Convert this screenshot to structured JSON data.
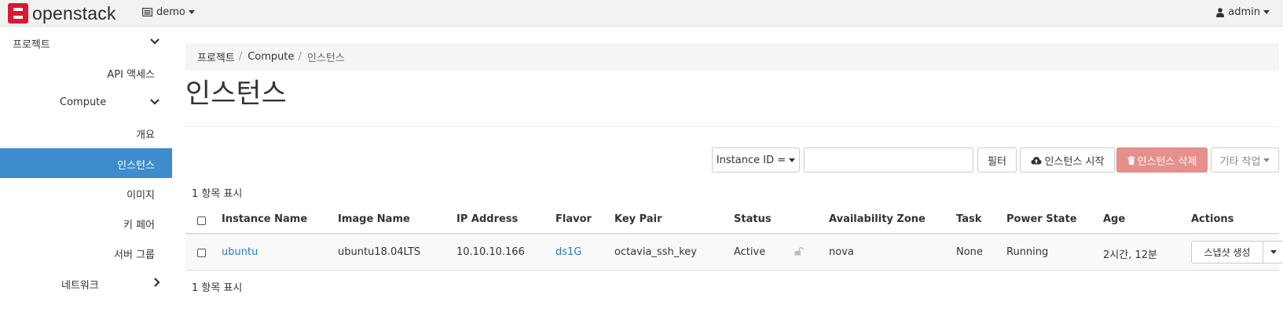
{
  "topbar": {
    "brand": "openstack",
    "project": "demo",
    "user": "admin"
  },
  "sidebar": {
    "items": [
      {
        "label": "프로젝트",
        "kind": "section",
        "expanded": true
      },
      {
        "label": "API 액세스",
        "kind": "link"
      },
      {
        "label": "Compute",
        "kind": "group",
        "expanded": true
      },
      {
        "label": "개요",
        "kind": "link"
      },
      {
        "label": "인스턴스",
        "kind": "link",
        "active": true
      },
      {
        "label": "이미지",
        "kind": "link"
      },
      {
        "label": "키 페어",
        "kind": "link"
      },
      {
        "label": "서버 그룹",
        "kind": "link"
      },
      {
        "label": "네트워크",
        "kind": "group",
        "expanded": false
      }
    ]
  },
  "breadcrumb": [
    "프로젝트",
    "Compute",
    "인스턴스"
  ],
  "page_title": "인스턴스",
  "toolbar": {
    "filter_field": "Instance ID =",
    "filter_value": "",
    "filter_button": "필터",
    "launch_button": "인스턴스 시작",
    "delete_button": "인스턴스 삭제",
    "more_button": "기타 작업"
  },
  "summary_top": "1 항목 표시",
  "summary_bottom": "1 항목 표시",
  "table": {
    "columns": [
      "Instance Name",
      "Image Name",
      "IP Address",
      "Flavor",
      "Key Pair",
      "Status",
      "Availability Zone",
      "Task",
      "Power State",
      "Age",
      "Actions"
    ],
    "rows": [
      {
        "instance_name": "ubuntu",
        "image_name": "ubuntu18.04LTS",
        "ip_address": "10.10.10.166",
        "flavor": "ds1G",
        "key_pair": "octavia_ssh_key",
        "status": "Active",
        "availability_zone": "nova",
        "task": "None",
        "power_state": "Running",
        "age": "2시간, 12분",
        "action": "스냅샷 생성"
      }
    ]
  },
  "colors": {
    "active_nav": "#3e8ccd",
    "link": "#2a7bbf",
    "danger_button": "#e6908d",
    "brand_red": "#da1a32"
  }
}
